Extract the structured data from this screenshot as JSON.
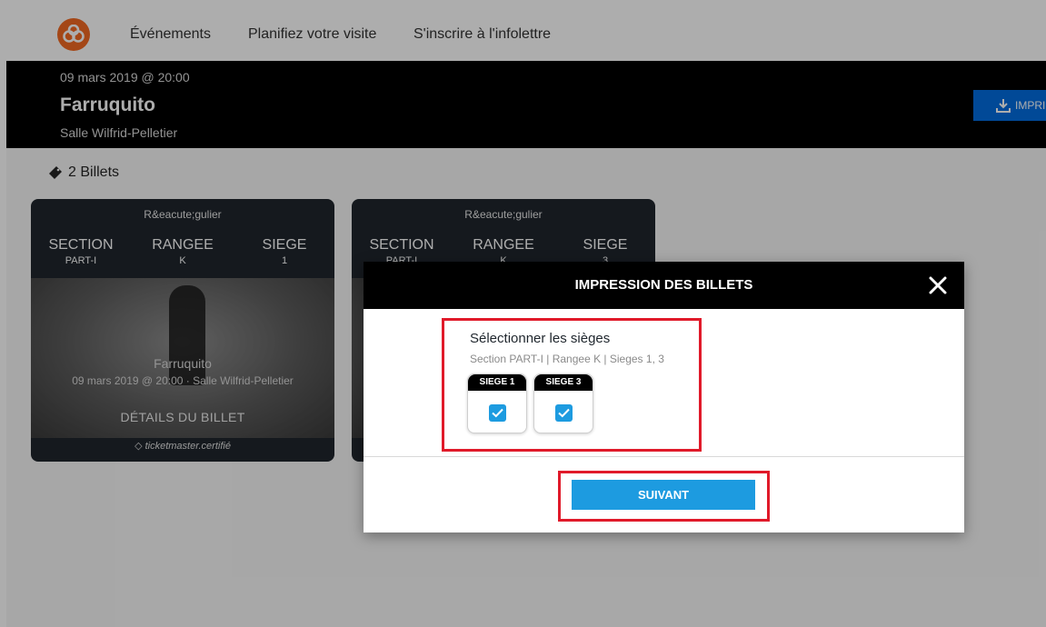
{
  "nav": {
    "items": [
      "Événements",
      "Planifiez votre visite",
      "S'inscrire à l'infolettre"
    ]
  },
  "event": {
    "date": "09 mars 2019 @ 20:00",
    "title": "Farruquito",
    "venue": "Salle Wilfrid-Pelletier",
    "print_label": "IMPRI"
  },
  "tickets": {
    "count_label": "2 Billets",
    "cards": [
      {
        "category": "R&eacute;gulier",
        "section_label": "SECTION",
        "section": "PART-I",
        "row_label": "RANGEE",
        "row": "K",
        "seat_label": "SIEGE",
        "seat": "1",
        "name": "Farruquito",
        "sub": "09 mars 2019 @ 20:00 · Salle Wilfrid-Pelletier",
        "details": "DÉTAILS DU BILLET",
        "certified": "ticketmaster.certifié"
      },
      {
        "category": "R&eacute;gulier",
        "section_label": "SECTION",
        "section": "PART-I",
        "row_label": "RANGEE",
        "row": "K",
        "seat_label": "SIEGE",
        "seat": "3"
      }
    ]
  },
  "modal": {
    "title": "IMPRESSION DES BILLETS",
    "select_label": "Sélectionner les sièges",
    "summary": "Section PART-I | Rangee K | Sieges 1, 3",
    "seats": [
      {
        "label": "SIEGE 1",
        "checked": true
      },
      {
        "label": "SIEGE 3",
        "checked": true
      }
    ],
    "next_label": "SUIVANT"
  },
  "colors": {
    "brand": "#f26922",
    "accent": "#1d9be0",
    "highlight": "#e01a2a"
  }
}
